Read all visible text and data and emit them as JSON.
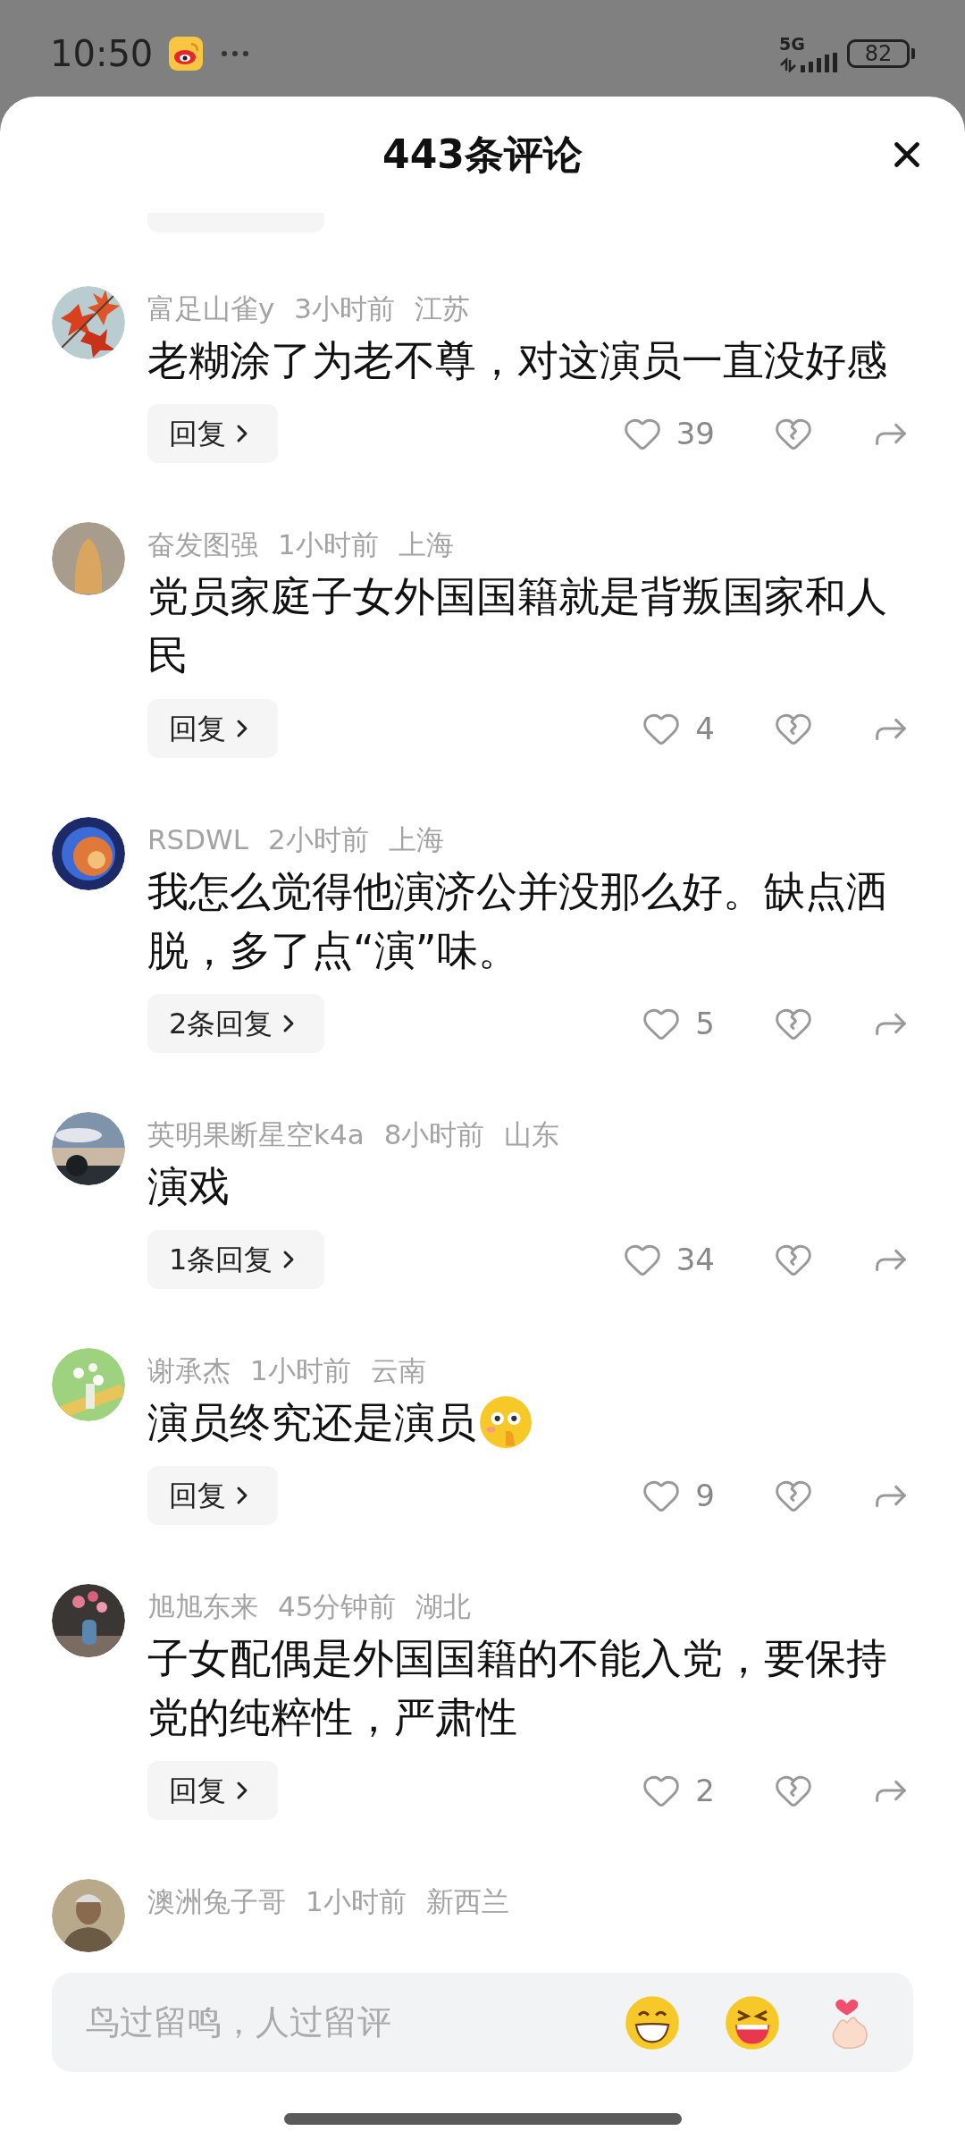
{
  "status_bar": {
    "time": "10:50",
    "network": "5G",
    "battery": "82"
  },
  "header": {
    "title": "443条评论"
  },
  "comments": [
    {
      "user": "富足山雀y",
      "time": "3小时前",
      "location": "江苏",
      "text": "老糊涂了为老不尊，对这演员一直没好感",
      "emoji": false,
      "reply_label": "回复",
      "likes": "39"
    },
    {
      "user": "奋发图强",
      "time": "1小时前",
      "location": "上海",
      "text": "党员家庭子女外国国籍就是背叛国家和人民",
      "emoji": false,
      "reply_label": "回复",
      "likes": "4"
    },
    {
      "user": "RSDWL",
      "time": "2小时前",
      "location": "上海",
      "text": "我怎么觉得他演济公并没那么好。缺点洒脱，多了点“演”味。",
      "emoji": false,
      "reply_label": "2条回复",
      "likes": "5"
    },
    {
      "user": "英明果断星空k4a",
      "time": "8小时前",
      "location": "山东",
      "text": "演戏",
      "emoji": false,
      "reply_label": "1条回复",
      "likes": "34"
    },
    {
      "user": "谢承杰",
      "time": "1小时前",
      "location": "云南",
      "text": "演员终究还是演员",
      "emoji": true,
      "reply_label": "回复",
      "likes": "9"
    },
    {
      "user": "旭旭东来",
      "time": "45分钟前",
      "location": "湖北",
      "text": "子女配偶是外国国籍的不能入党，要保持党的纯粹性，严肃性",
      "emoji": false,
      "reply_label": "回复",
      "likes": "2"
    },
    {
      "user": "澳洲兔子哥",
      "time": "1小时前",
      "location": "新西兰"
    }
  ],
  "input": {
    "placeholder": "鸟过留鸣，人过留评"
  }
}
